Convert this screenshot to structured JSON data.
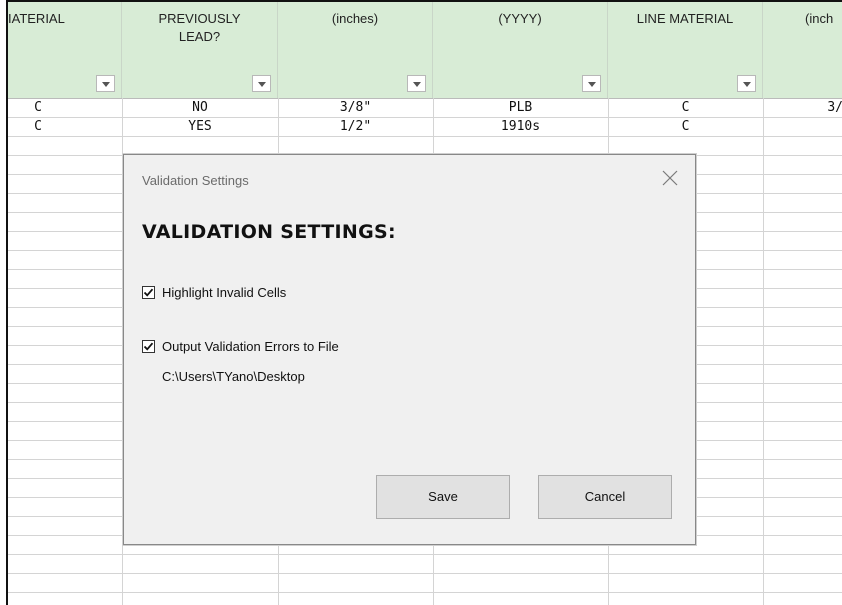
{
  "spreadsheet": {
    "headers": [
      {
        "top_fragment": "· · · · · · ·",
        "label": "IATERIAL",
        "has_filter": true
      },
      {
        "top_fragment": "· · · · · · · · · ·",
        "label": "PREVIOUSLY\nLEAD?",
        "has_filter": true
      },
      {
        "top_fragment": "· · · · · · ·",
        "label": "(inches)",
        "has_filter": true
      },
      {
        "top_fragment": "· · · · · · · · · · ·",
        "label": "(YYYY)",
        "has_filter": true
      },
      {
        "top_fragment": "· · · · · · · · · ·",
        "label": "LINE MATERIAL",
        "has_filter": true
      },
      {
        "top_fragment": "· · · ·",
        "label": "(inch",
        "has_filter": false
      }
    ],
    "rows": [
      [
        "C",
        "NO",
        "3/8\"",
        "PLB",
        "C",
        "3/"
      ],
      [
        "C",
        "YES",
        "1/2\"",
        "1910s",
        "C",
        ""
      ]
    ]
  },
  "dialog": {
    "title": "Validation Settings",
    "heading": "VALIDATION SETTINGS:",
    "options": [
      {
        "label": "Highlight Invalid Cells",
        "checked": true
      },
      {
        "label": "Output Validation Errors to File",
        "checked": true
      }
    ],
    "output_path": "C:\\Users\\TYano\\Desktop",
    "save_label": "Save",
    "cancel_label": "Cancel"
  }
}
